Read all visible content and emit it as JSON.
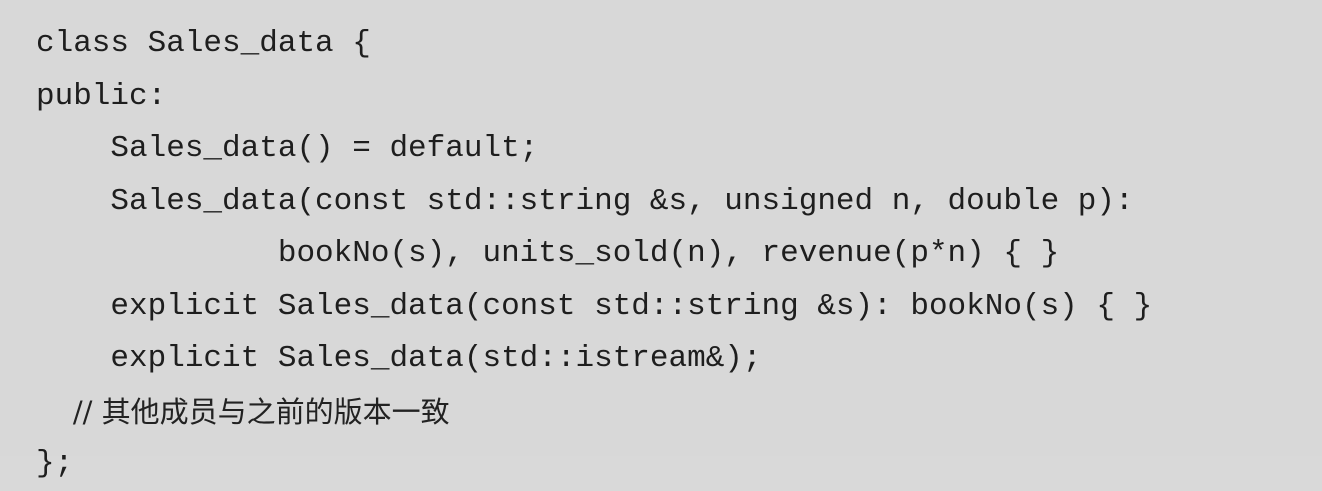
{
  "code": {
    "lines": [
      "class Sales_data {",
      "public:",
      "    Sales_data() = default;",
      "    Sales_data(const std::string &s, unsigned n, double p):",
      "             bookNo(s), units_sold(n), revenue(p*n) { }",
      "    explicit Sales_data(const std::string &s): bookNo(s) { }",
      "    explicit Sales_data(std::istream&);",
      "    // 其他成员与之前的版本一致",
      "};"
    ]
  }
}
